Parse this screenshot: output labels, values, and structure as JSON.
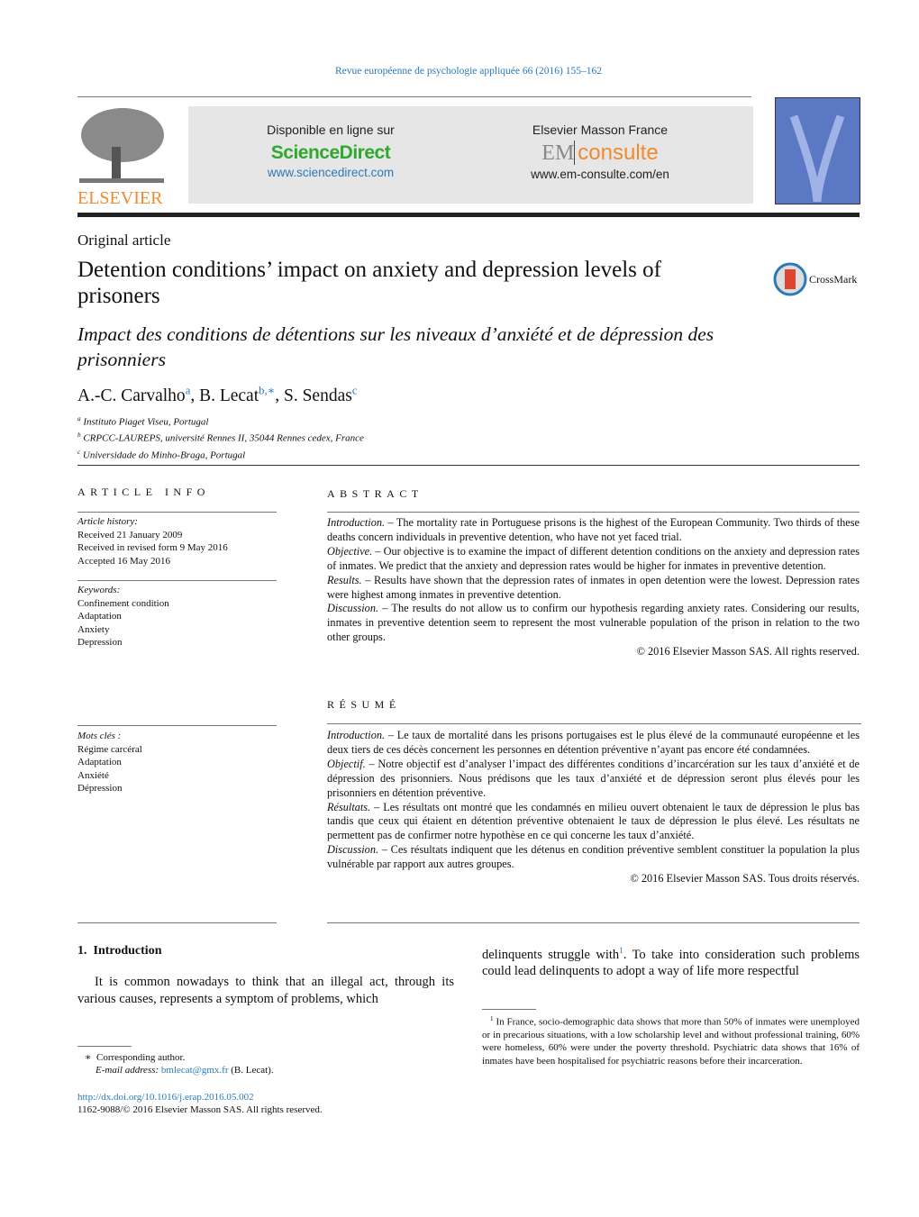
{
  "journal_header": "Revue européenne de psychologie appliquée 66 (2016) 155–162",
  "banner": {
    "left_label": "Disponible en ligne sur",
    "left_brand": "ScienceDirect",
    "left_url": "www.sciencedirect.com",
    "right_label": "Elsevier Masson France",
    "right_brand_em": "EM",
    "right_brand_consulte": "consulte",
    "right_url": "www.em-consulte.com/en"
  },
  "publisher_logo": "ELSEVIER",
  "crossmark": "CrossMark",
  "article_type": "Original article",
  "title": "Detention conditions’ impact on anxiety and depression levels of prisoners",
  "title_fr": "Impact des conditions de détentions sur les niveaux d’anxiété et de dépression des prisonniers",
  "authors": [
    {
      "name": "A.-C. Carvalho",
      "sup": "a"
    },
    {
      "name": "B. Lecat",
      "sup": "b,∗"
    },
    {
      "name": "S. Sendas",
      "sup": "c"
    }
  ],
  "affiliations": [
    {
      "sup": "a",
      "text": "Instituto Piaget Viseu, Portugal"
    },
    {
      "sup": "b",
      "text": "CRPCC-LAUREPS, université Rennes II, 35044 Rennes cedex, France"
    },
    {
      "sup": "c",
      "text": "Universidade do Minho-Braga, Portugal"
    }
  ],
  "article_info": {
    "heading": "ARTICLE INFO",
    "history_label": "Article history:",
    "history": [
      "Received 21 January 2009",
      "Received in revised form 9 May 2016",
      "Accepted 16 May 2016"
    ],
    "keywords_label": "Keywords:",
    "keywords": [
      "Confinement condition",
      "Adaptation",
      "Anxiety",
      "Depression"
    ],
    "mots_label": "Mots clés :",
    "mots": [
      "Régime carcéral",
      "Adaptation",
      "Anxiété",
      "Dépression"
    ]
  },
  "abstract": {
    "heading": "ABSTRACT",
    "paragraphs": [
      {
        "label": "Introduction.",
        "text": " – The mortality rate in Portuguese prisons is the highest of the European Community. Two thirds of these deaths concern individuals in preventive detention, who have not yet faced trial."
      },
      {
        "label": "Objective.",
        "text": " – Our objective is to examine the impact of different detention conditions on the anxiety and depression rates of inmates. We predict that the anxiety and depression rates would be higher for inmates in preventive detention."
      },
      {
        "label": "Results.",
        "text": " – Results have shown that the depression rates of inmates in open detention were the lowest. Depression rates were highest among inmates in preventive detention."
      },
      {
        "label": "Discussion.",
        "text": " – The results do not allow us to confirm our hypothesis regarding anxiety rates. Considering our results, inmates in preventive detention seem to represent the most vulnerable population of the prison in relation to the two other groups."
      }
    ],
    "copyright": "© 2016 Elsevier Masson SAS. All rights reserved."
  },
  "resume": {
    "heading": "RÉSUMÉ",
    "paragraphs": [
      {
        "label": "Introduction.",
        "text": " – Le taux de mortalité dans les prisons portugaises est le plus élevé de la communauté européenne et les deux tiers de ces décès concernent les personnes en détention préventive n’ayant pas encore été condamnées."
      },
      {
        "label": "Objectif.",
        "text": " – Notre objectif est d’analyser l’impact des différentes conditions d’incarcération sur les taux d’anxiété et de dépression des prisonniers. Nous prédisons que les taux d’anxiété et de dépression seront plus élevés pour les prisonniers en détention préventive."
      },
      {
        "label": "Résultats.",
        "text": " – Les résultats ont montré que les condamnés en milieu ouvert obtenaient le taux de dépression le plus bas tandis que ceux qui étaient en détention préventive obtenaient le taux de dépression le plus élevé. Les résultats ne permettent pas de confirmer notre hypothèse en ce qui concerne les taux d’anxiété."
      },
      {
        "label": "Discussion.",
        "text": " – Ces résultats indiquent que les détenus en condition préventive semblent constituer la population la plus vulnérable par rapport aux autres groupes."
      }
    ],
    "copyright": "© 2016 Elsevier Masson SAS. Tous droits réservés."
  },
  "intro": {
    "heading_num": "1.",
    "heading": "Introduction",
    "col1": "It is common nowadays to think that an illegal act, through its various causes, represents a symptom of problems, which",
    "col2_a": "delinquents struggle with",
    "col2_sup": "1",
    "col2_b": ". To take into consideration such problems could lead delinquents to adopt a way of life more respectful"
  },
  "footnote": {
    "sup": "1",
    "text": "In France, socio-demographic data shows that more than 50% of inmates were unemployed or in precarious situations, with a low scholarship level and without professional training, 60% were homeless, 60% were under the poverty threshold. Psychiatric data shows that 16% of inmates have been hospitalised for psychiatric reasons before their incarceration."
  },
  "corresponding": {
    "mark": "∗",
    "text": "Corresponding author.",
    "email_label": "E-mail address:",
    "email": "bmlecat@gmx.fr",
    "email_suffix": " (B. Lecat)."
  },
  "doi": "http://dx.doi.org/10.1016/j.erap.2016.05.002",
  "issn": "1162-9088/© 2016 Elsevier Masson SAS. All rights reserved."
}
